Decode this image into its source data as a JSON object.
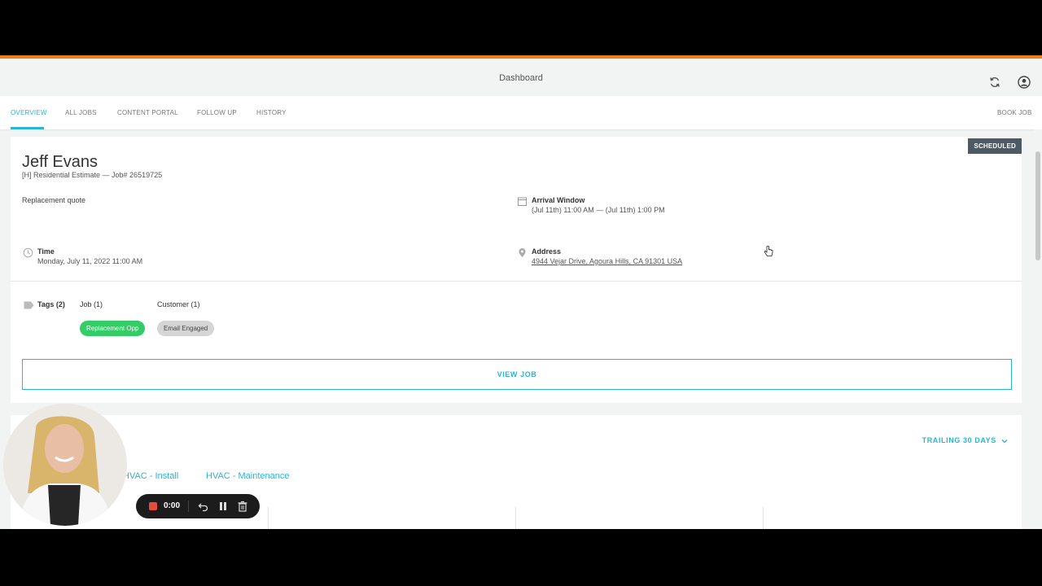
{
  "header": {
    "title": "Dashboard"
  },
  "tabs": [
    {
      "label": "OVERVIEW"
    },
    {
      "label": "ALL JOBS"
    },
    {
      "label": "CONTENT PORTAL"
    },
    {
      "label": "FOLLOW UP"
    },
    {
      "label": "HISTORY"
    }
  ],
  "book_job": "BOOK JOB",
  "job": {
    "status": "SCHEDULED",
    "customer_name": "Jeff Evans",
    "subtitle": "[H] Residential Estimate — Job# 26519725",
    "description": "Replacement quote",
    "arrival_label": "Arrival Window",
    "arrival_value": "(Jul 11th) 11:00 AM — (Jul 11th) 1:00 PM",
    "time_label": "Time",
    "time_value": "Monday, July 11, 2022 11:00 AM",
    "address_label": "Address",
    "address_value": "4944 Vejar Drive, Agoura Hills, CA 91301 USA",
    "tags_label": "Tags (2)",
    "tag_job_label": "Job (1)",
    "tag_customer_label": "Customer (1)",
    "tags": [
      "Replacement Opp",
      "Email Engaged"
    ],
    "view_job": "VIEW JOB"
  },
  "stats": {
    "trailing": "TRAILING 30 DAYS",
    "filters": [
      "HVAC - Install",
      "HVAC - Maintenance"
    ]
  },
  "recorder": {
    "time": "0:00"
  },
  "colors": {
    "accent": "#f07c1b",
    "link": "#2bb5d0",
    "tag_green": "#33cc66",
    "status": "#4d5a63"
  }
}
